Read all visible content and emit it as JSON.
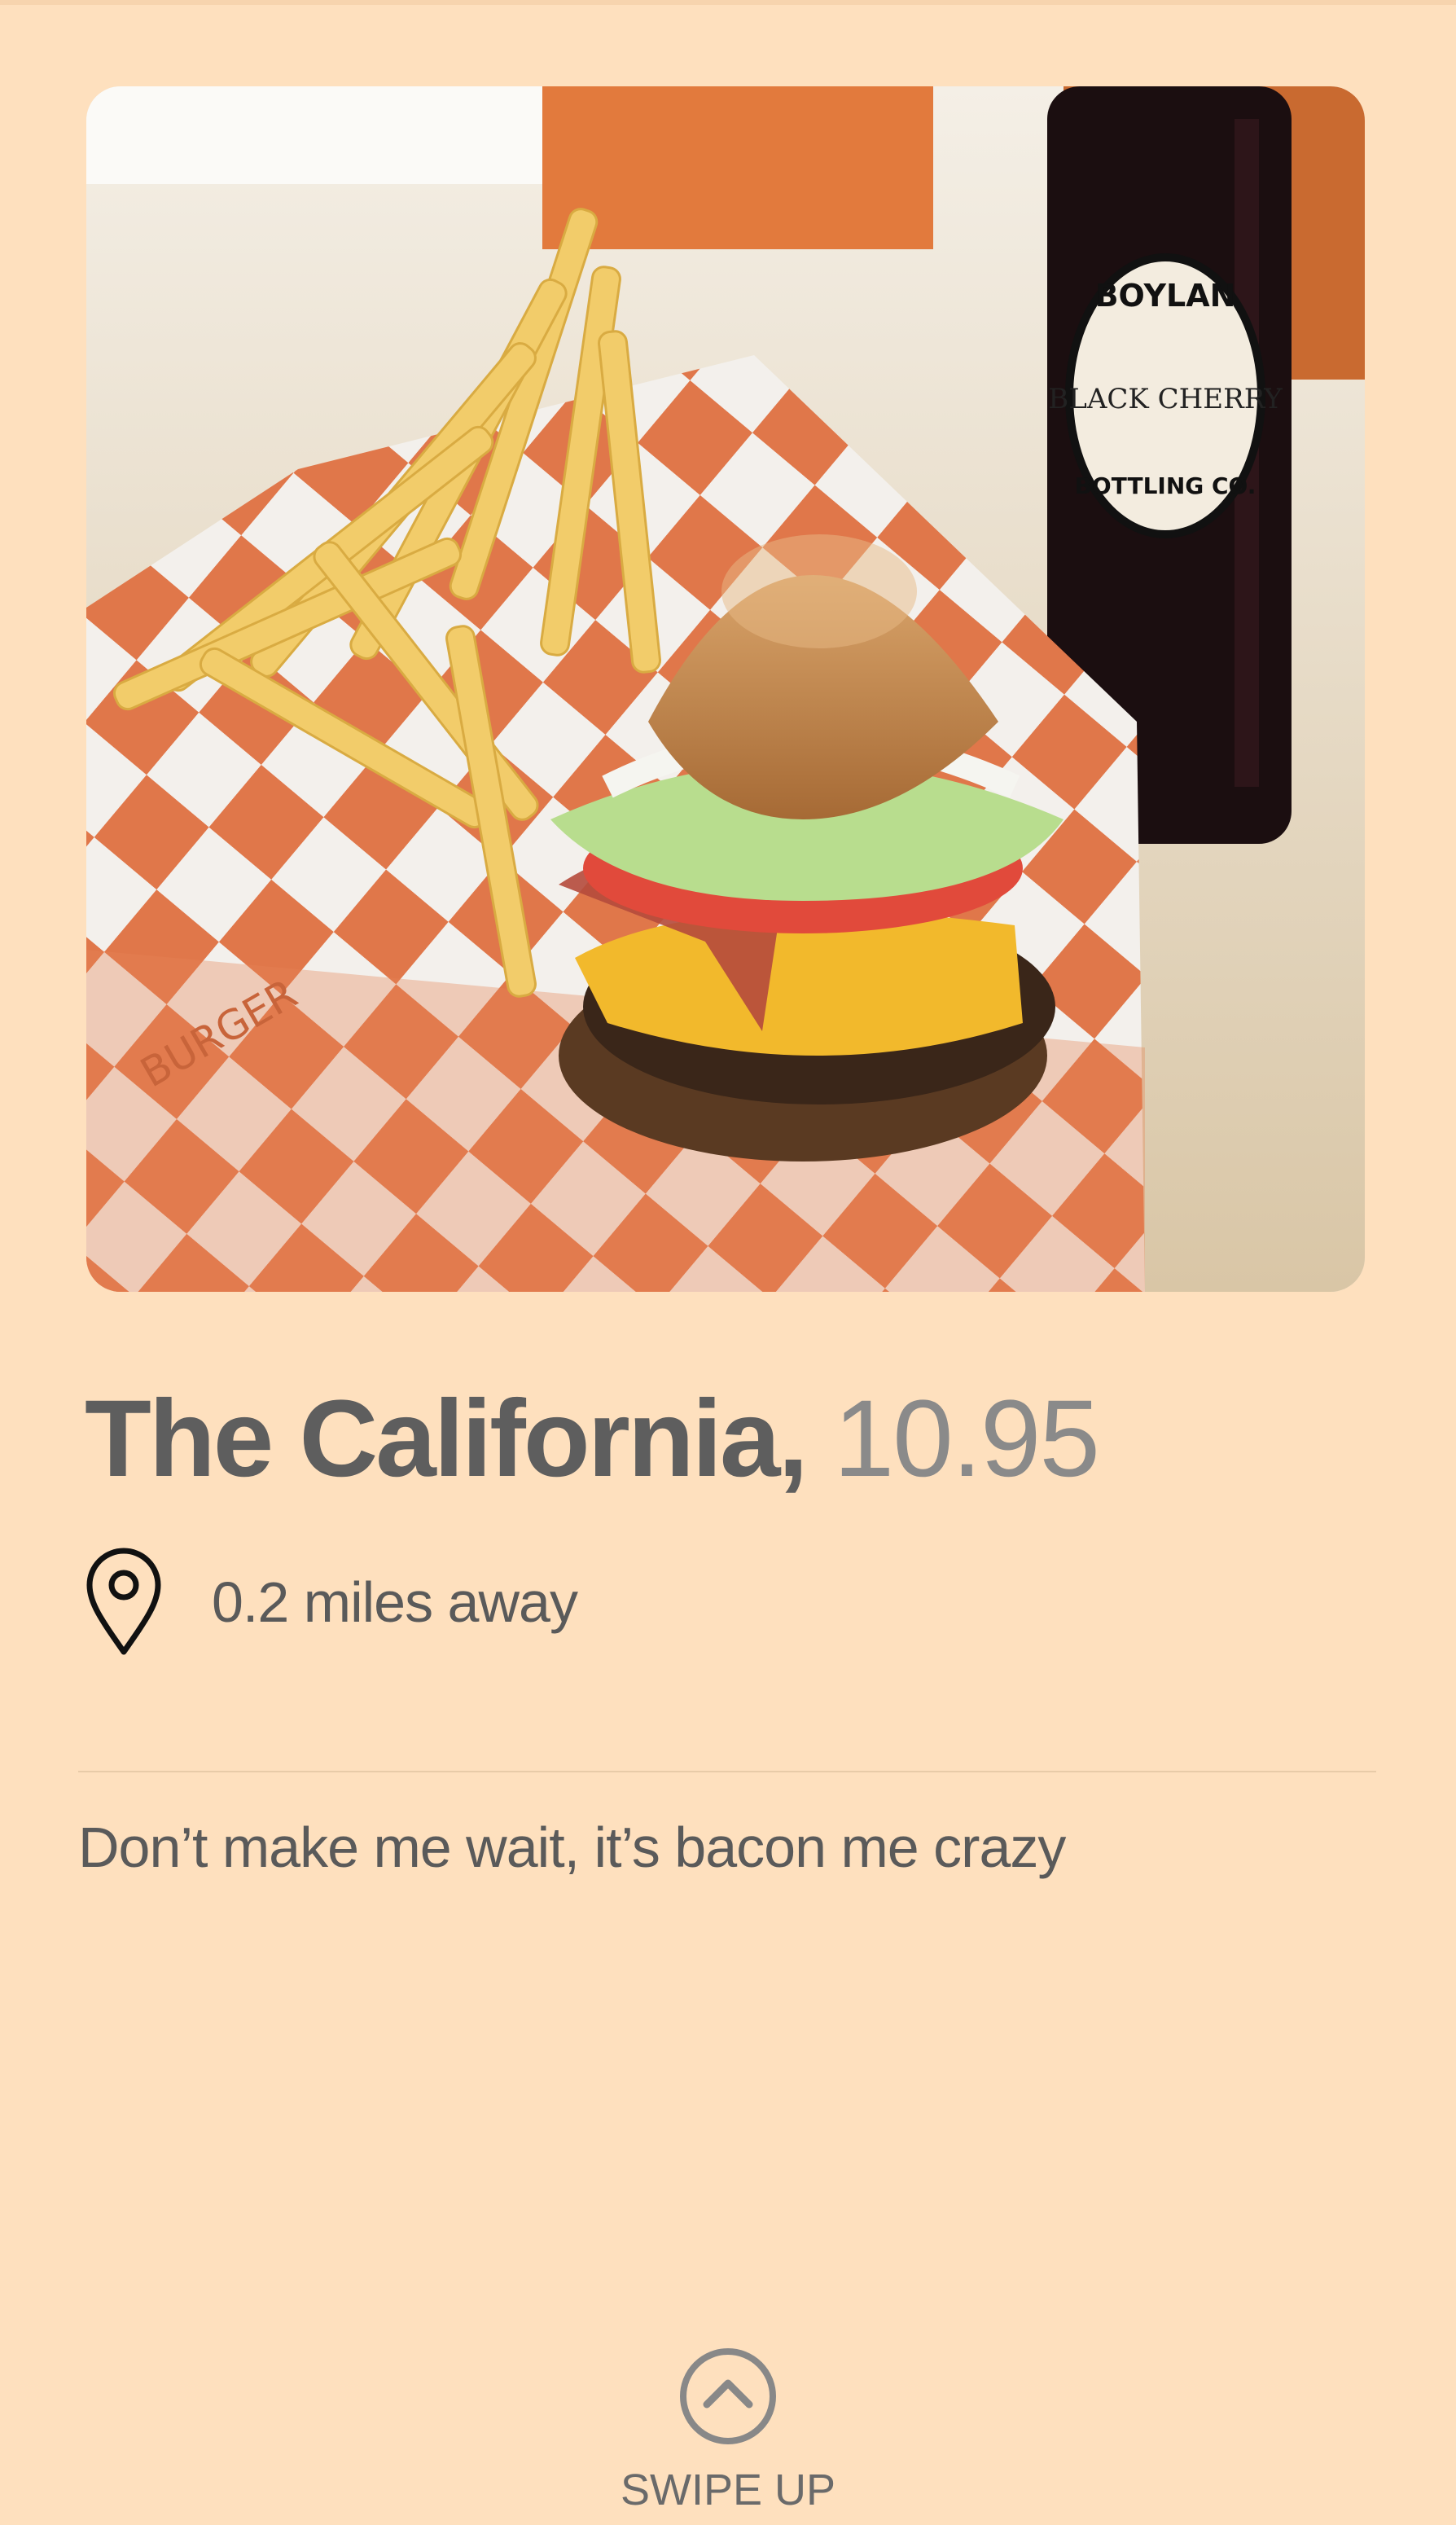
{
  "item": {
    "name": "The California,",
    "price": "10.95",
    "distance": "0.2 miles away",
    "tagline": "Don’t make me wait, it’s bacon me crazy"
  },
  "photo": {
    "bottle_label_top": "BOYLAN",
    "bottle_label_mid": "BLACK CHERRY",
    "bottle_label_bottom": "BOTTLING CO.",
    "paper_brand": "BURGER"
  },
  "footer": {
    "swipe_label": "SWIPE UP"
  },
  "icons": {
    "location": "map-pin-icon",
    "swipe": "chevron-up-circle-icon"
  },
  "colors": {
    "background": "#FEE0BE",
    "title": "#5E5E5E",
    "price": "#8A8A8A",
    "body_text": "#5A5A5A"
  }
}
